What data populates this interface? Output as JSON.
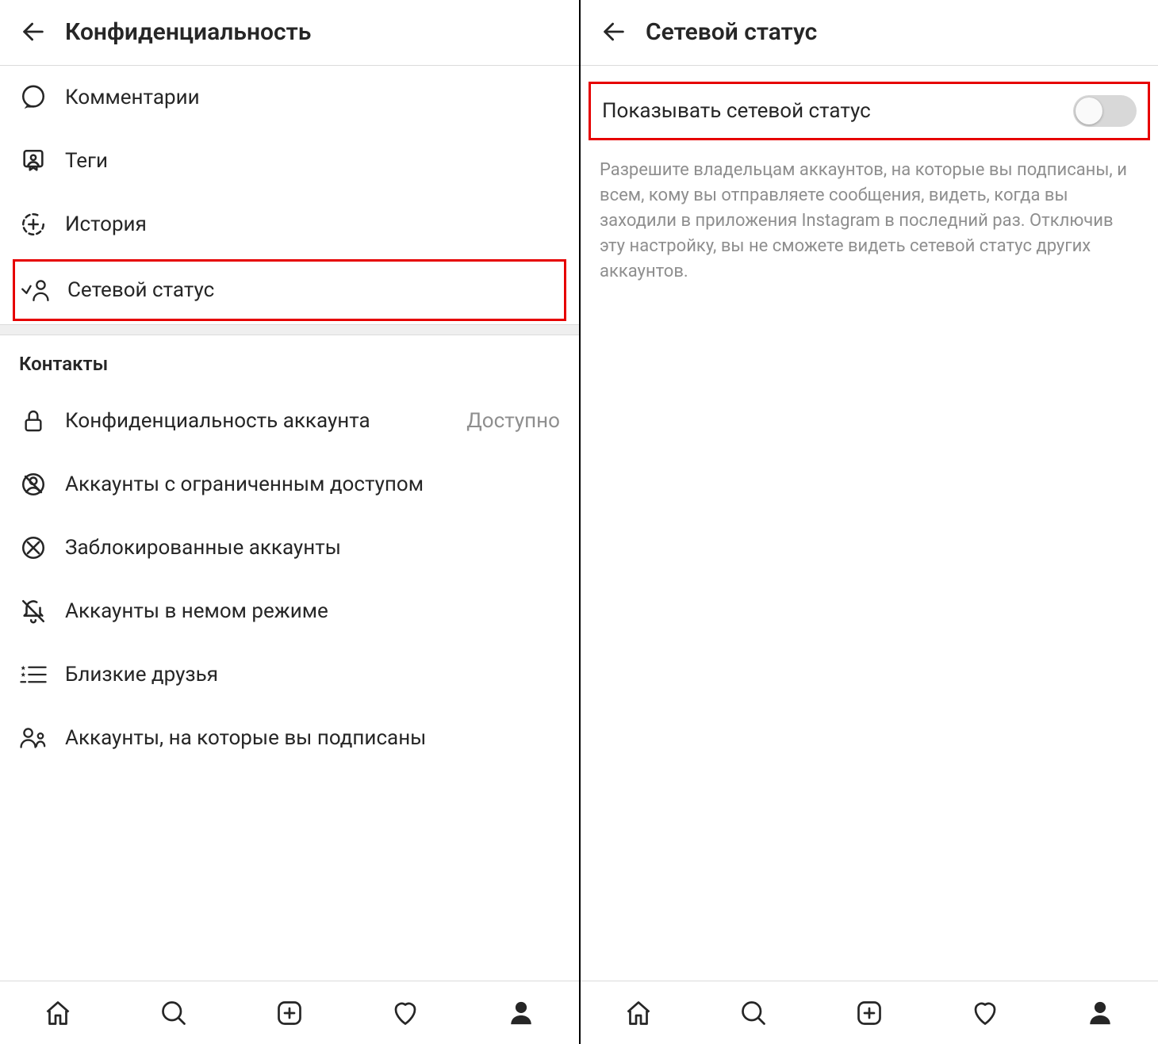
{
  "left": {
    "title": "Конфиденциальность",
    "items": [
      {
        "icon": "comment",
        "label": "Комментарии"
      },
      {
        "icon": "tag",
        "label": "Теги"
      },
      {
        "icon": "story",
        "label": "История"
      },
      {
        "icon": "activity",
        "label": "Сетевой статус",
        "highlight": true
      }
    ],
    "section_title": "Контакты",
    "contacts": [
      {
        "icon": "lock",
        "label": "Конфиденциальность аккаунта",
        "trailing": "Доступно"
      },
      {
        "icon": "restricted",
        "label": "Аккаунты с ограниченным доступом"
      },
      {
        "icon": "blocked",
        "label": "Заблокированные аккаунты"
      },
      {
        "icon": "muted",
        "label": "Аккаунты в немом режиме"
      },
      {
        "icon": "closefriends",
        "label": "Близкие друзья"
      },
      {
        "icon": "following",
        "label": "Аккаунты, на которые вы подписаны"
      }
    ]
  },
  "right": {
    "title": "Сетевой статус",
    "toggle_label": "Показывать сетевой статус",
    "toggle_on": false,
    "description": "Разрешите владельцам аккаунтов, на которые вы подписаны, и всем, кому вы отправляете сообщения, видеть, когда вы заходили в приложения Instagram в последний раз. Отключив эту настройку, вы не сможете видеть сетевой статус других аккаунтов."
  },
  "nav": {
    "items": [
      "home",
      "search",
      "add",
      "activity",
      "profile"
    ],
    "active": "profile"
  }
}
